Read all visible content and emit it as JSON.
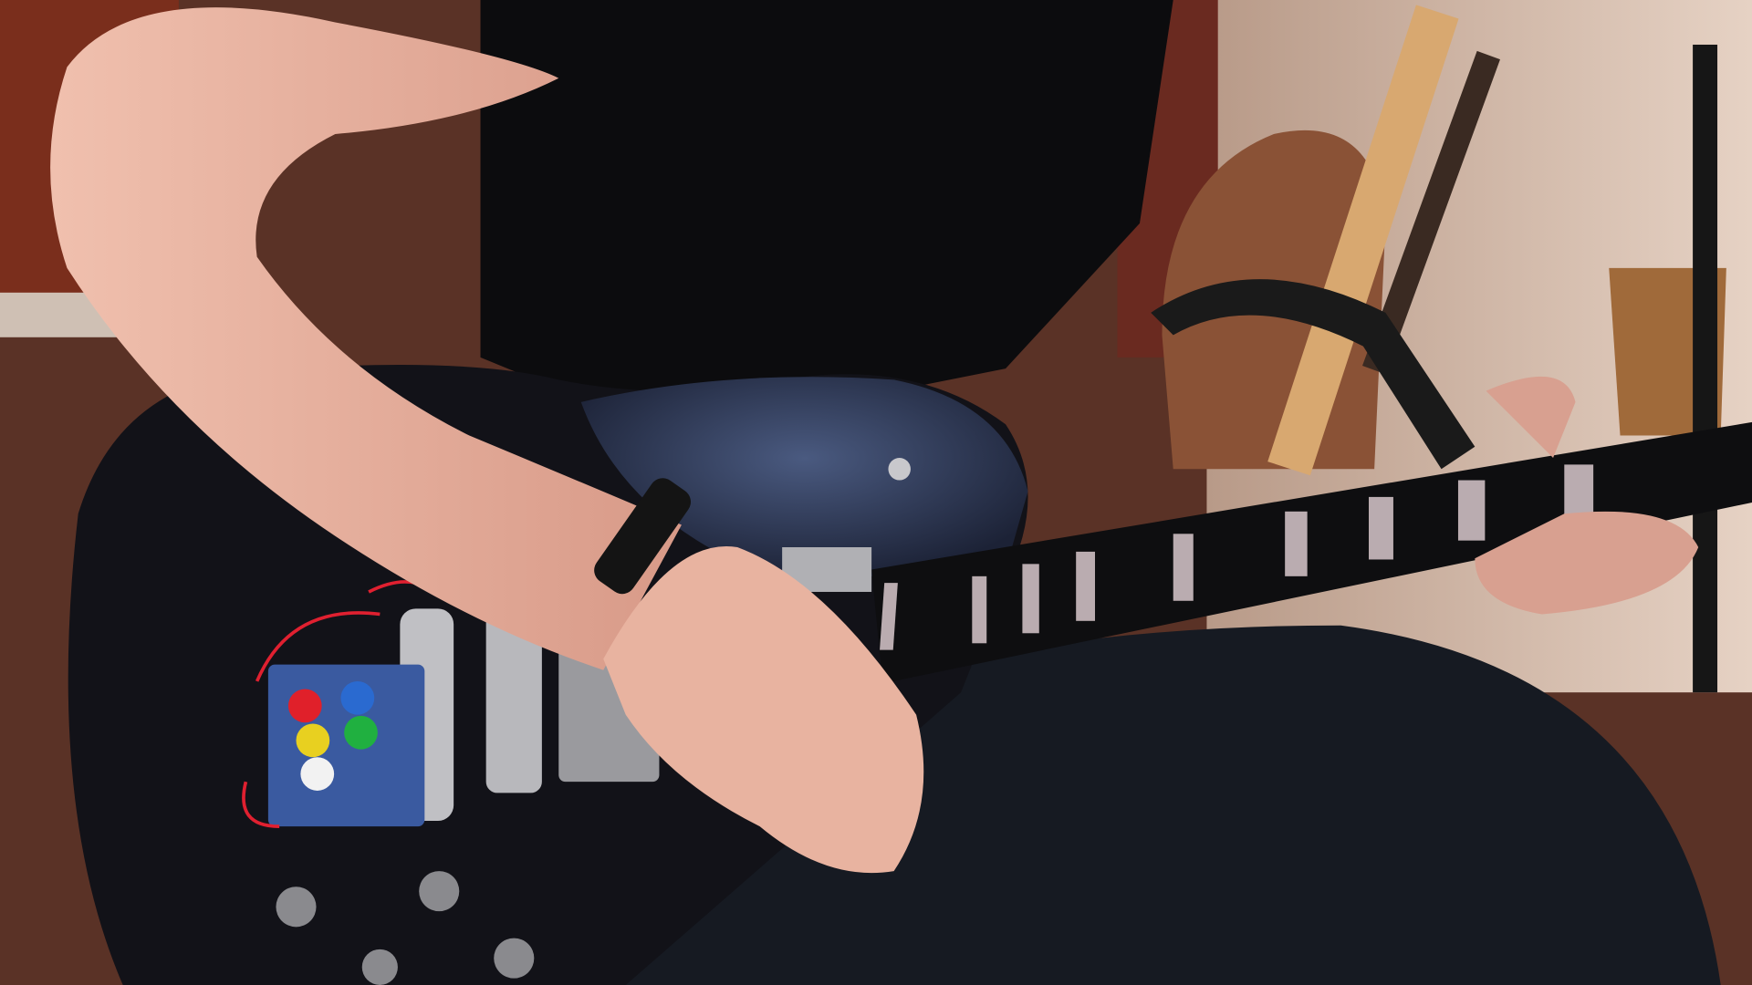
{
  "scene": {
    "description_tags": [
      "guitar",
      "hand",
      "arm",
      "controller-buttons"
    ],
    "colors": {
      "floor": "#6b3b2c",
      "wall": "#d9c2b0",
      "shirt": "#0c0c0e",
      "skin": "#e8b3a0",
      "guitar_body": "#121218",
      "guitar_top": "#2d3550",
      "jeans": "#161a22",
      "fret_inlay": "#d8c8cc",
      "button_red": "#e0202a",
      "button_blue": "#2a6ad0",
      "button_yellow": "#e8d020",
      "button_green": "#20b040",
      "button_white": "#f2f2f2",
      "board": "#3a5aa0"
    }
  }
}
